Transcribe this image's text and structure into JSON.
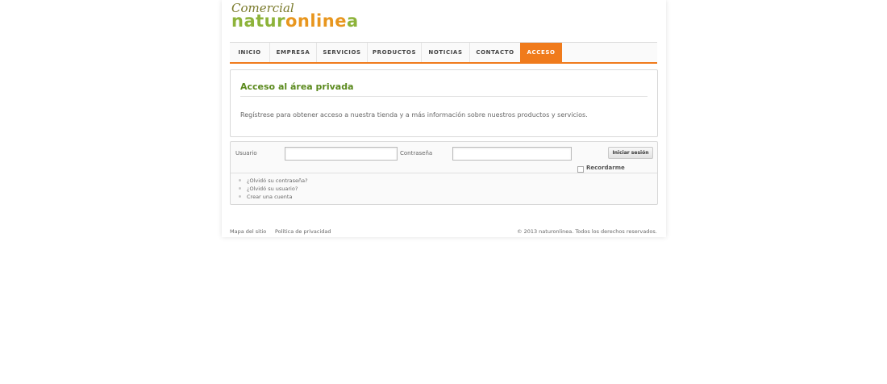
{
  "logo": {
    "script_text": "Comercial",
    "brand_part1": "natur",
    "brand_part2": "online",
    "brand_part3": "a"
  },
  "nav": {
    "items": [
      {
        "label": "INICIO",
        "active": false
      },
      {
        "label": "EMPRESA",
        "active": false
      },
      {
        "label": "SERVICIOS",
        "active": false
      },
      {
        "label": "PRODUCTOS",
        "active": false
      },
      {
        "label": "NOTICIAS",
        "active": false
      },
      {
        "label": "CONTACTO",
        "active": false
      },
      {
        "label": "ACCESO",
        "active": true
      }
    ]
  },
  "intro": {
    "title": "Acceso al área privada",
    "text": "Regístrese para obtener acceso a nuestra tienda y a más información sobre nuestros productos y servicios."
  },
  "login": {
    "username_label": "Usuario",
    "username_value": "",
    "password_label": "Contraseña",
    "password_value": "",
    "submit_label": "Iniciar sesión",
    "remember_label": "Recordarme",
    "remember_checked": false,
    "links": [
      "¿Olvidó su contraseña?",
      "¿Olvidó su usuario?",
      "Crear una cuenta"
    ]
  },
  "footer": {
    "sitemap": "Mapa del sitio",
    "privacy": "Política de privacidad",
    "copyright": "© 2013 naturonlinea. Todos los derechos reservados."
  },
  "colors": {
    "accent": "#f07b1c",
    "title_green": "#5b8a1e",
    "logo_green": "#8db33a",
    "logo_orange": "#e8961e"
  }
}
